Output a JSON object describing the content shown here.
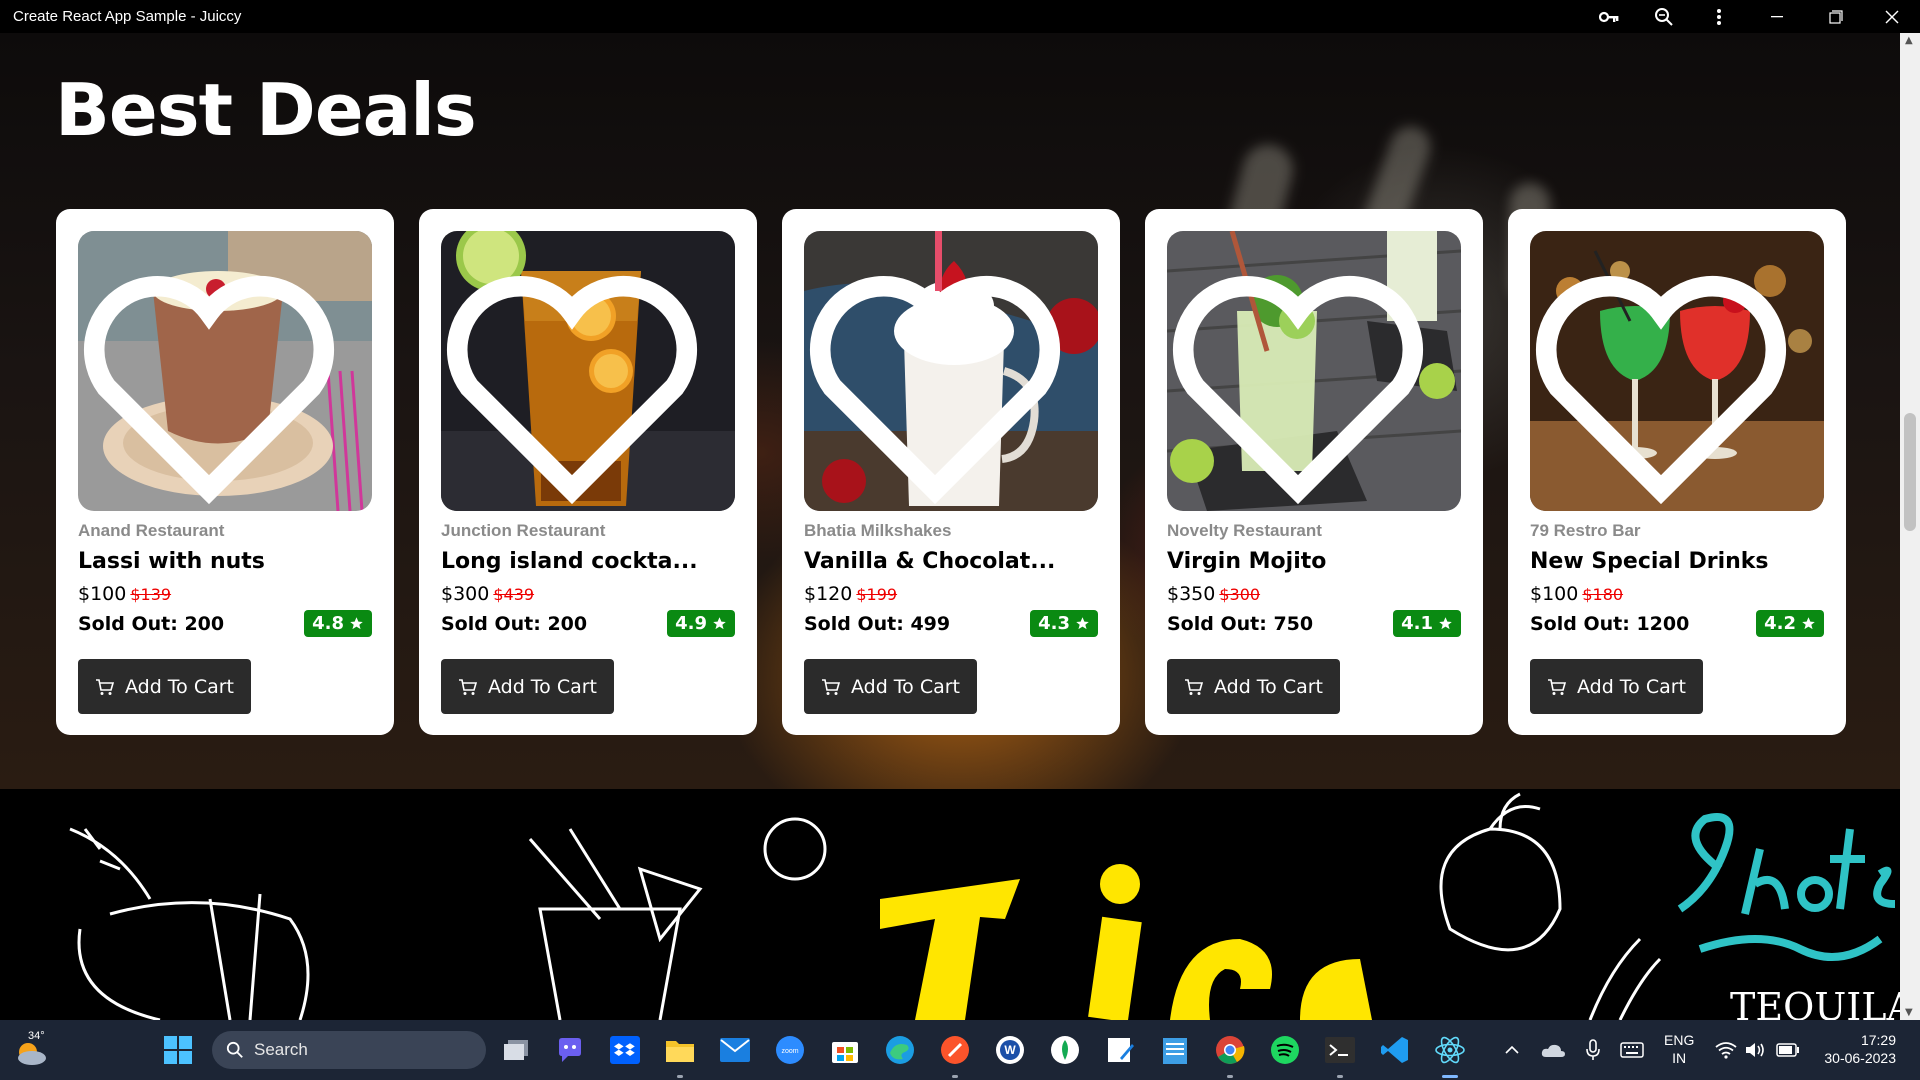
{
  "window": {
    "title": "Create React App Sample - Juiccy",
    "icons": [
      "key-icon",
      "zoom-icon",
      "more-icon",
      "minimize-icon",
      "maximize-icon",
      "close-icon"
    ]
  },
  "section": {
    "title": "Best Deals"
  },
  "cards": [
    {
      "restaurant": "Anand Restaurant",
      "name": "Lassi with nuts",
      "price": "$100",
      "old_price": "$139",
      "sold": "Sold Out: 200",
      "rating": "4.8",
      "button": "Add To Cart"
    },
    {
      "restaurant": "Junction Restaurant",
      "name": "Long island cockta...",
      "price": "$300",
      "old_price": "$439",
      "sold": "Sold Out: 200",
      "rating": "4.9",
      "button": "Add To Cart"
    },
    {
      "restaurant": "Bhatia Milkshakes",
      "name": "Vanilla & Chocolat...",
      "price": "$120",
      "old_price": "$199",
      "sold": "Sold Out: 499",
      "rating": "4.3",
      "button": "Add To Cart"
    },
    {
      "restaurant": "Novelty Restaurant",
      "name": "Virgin Mojito",
      "price": "$350",
      "old_price": "$300",
      "sold": "Sold Out: 750",
      "rating": "4.1",
      "button": "Add To Cart"
    },
    {
      "restaurant": "79 Restro Bar",
      "name": "New Special Drinks",
      "price": "$100",
      "old_price": "$180",
      "sold": "Sold Out: 1200",
      "rating": "4.2",
      "button": "Add To Cart"
    }
  ],
  "colors": {
    "rating_bg": "#0a8a12",
    "old_price": "#e00000",
    "button_bg": "#2b2b2b",
    "taskbar": "#1c2535"
  },
  "taskbar": {
    "weather_temp": "34°",
    "search_placeholder": "Search",
    "apps": [
      "windows-start-icon",
      "task-view-icon",
      "chat-icon",
      "dropbox-icon",
      "file-explorer-icon",
      "mail-icon",
      "zoom-app-icon",
      "store-icon",
      "edge-icon",
      "brave-icon",
      "word-app-icon",
      "mongodb-icon",
      "paint-icon",
      "notepad-icon",
      "chrome-icon",
      "spotify-icon",
      "terminal-icon",
      "vscode-icon",
      "react-app-icon"
    ],
    "lang_top": "ENG",
    "lang_bottom": "IN",
    "time": "17:29",
    "date": "30-06-2023"
  }
}
